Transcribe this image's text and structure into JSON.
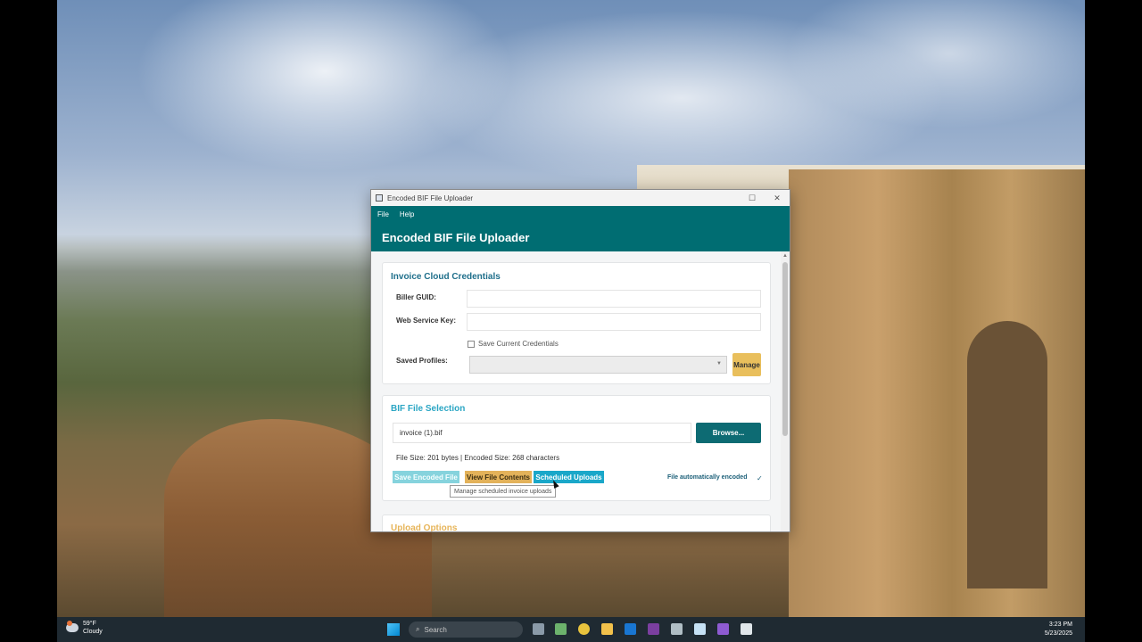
{
  "window": {
    "title": "Encoded BIF File Uploader",
    "menu": [
      "File",
      "Help"
    ],
    "header_title": "Encoded BIF File Uploader"
  },
  "credentials": {
    "title": "Invoice Cloud Credentials",
    "biller_guid_label": "Biller GUID:",
    "biller_guid_value": "",
    "web_service_key_label": "Web Service Key:",
    "web_service_key_value": "",
    "save_checkbox_label": "Save Current Credentials",
    "saved_profiles_label": "Saved Profiles:",
    "saved_profiles_value": "",
    "manage_button": "Manage"
  },
  "bif_selection": {
    "title": "BIF File Selection",
    "file_name": "invoice (1).bif",
    "browse_button": "Browse...",
    "file_info": "File Size: 201 bytes | Encoded Size: 268 characters",
    "save_encoded_button": "Save Encoded File",
    "view_contents_button": "View File Contents",
    "scheduled_uploads_button": "Scheduled Uploads",
    "status_text": "File automatically encoded",
    "status_icon": "checkmark-icon",
    "tooltip": "Manage scheduled invoice uploads"
  },
  "upload_options": {
    "title": "Upload Options"
  },
  "taskbar": {
    "weather_temp": "59°F",
    "weather_condition": "Cloudy",
    "search_placeholder": "Search",
    "time": "3:23 PM",
    "date": "5/23/2025"
  },
  "colors": {
    "header_teal": "#006d72",
    "accent_orange": "#e9bf5c",
    "accent_cyan": "#1aa7c9"
  }
}
